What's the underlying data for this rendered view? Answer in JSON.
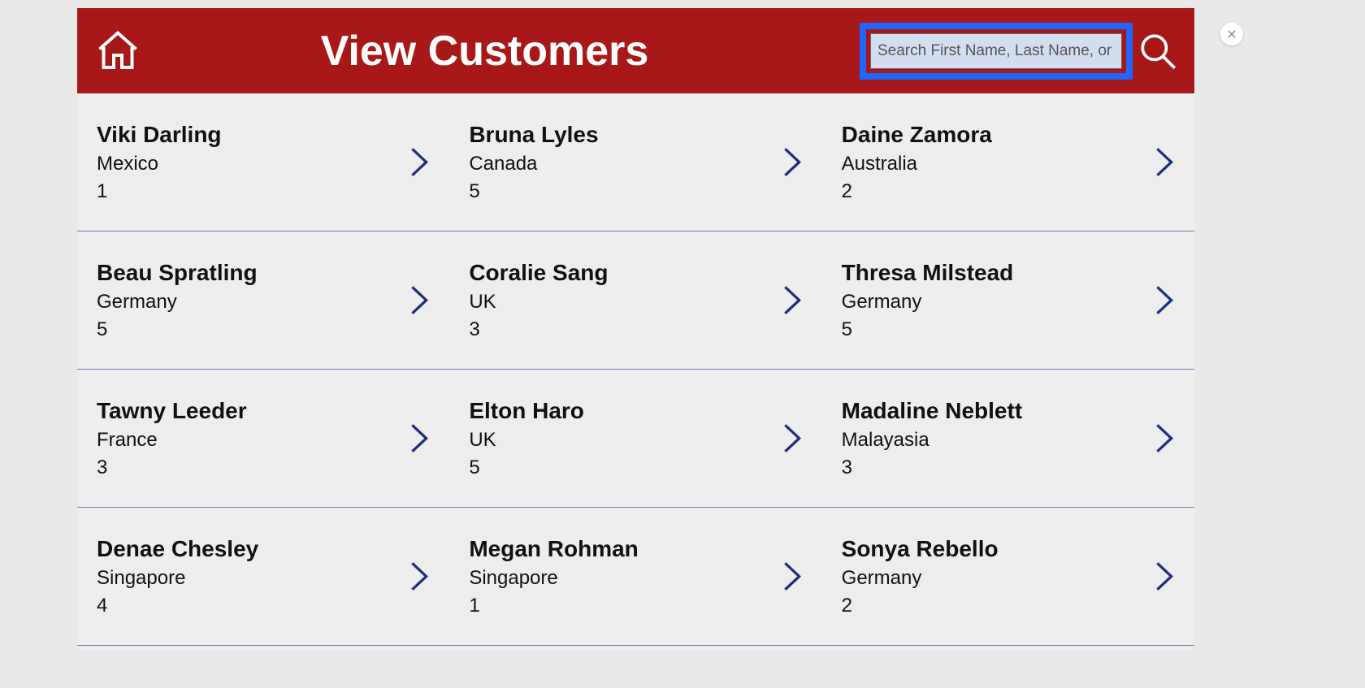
{
  "header": {
    "title": "View Customers"
  },
  "search": {
    "placeholder": "Search First Name, Last Name, or Age",
    "value": ""
  },
  "customers": [
    {
      "first": "Viki",
      "last": "Darling",
      "country": "Mexico",
      "num": "1"
    },
    {
      "first": "Bruna",
      "last": "Lyles",
      "country": "Canada",
      "num": "5"
    },
    {
      "first": "Daine",
      "last": "Zamora",
      "country": "Australia",
      "num": "2"
    },
    {
      "first": "Beau",
      "last": "Spratling",
      "country": "Germany",
      "num": "5"
    },
    {
      "first": "Coralie",
      "last": "Sang",
      "country": "UK",
      "num": "3"
    },
    {
      "first": "Thresa",
      "last": "Milstead",
      "country": "Germany",
      "num": "5"
    },
    {
      "first": "Tawny",
      "last": "Leeder",
      "country": "France",
      "num": "3"
    },
    {
      "first": "Elton",
      "last": "Haro",
      "country": "UK",
      "num": "5"
    },
    {
      "first": "Madaline",
      "last": "Neblett",
      "country": "Malayasia",
      "num": "3"
    },
    {
      "first": "Denae",
      "last": "Chesley",
      "country": "Singapore",
      "num": "4"
    },
    {
      "first": "Megan",
      "last": "Rohman",
      "country": "Singapore",
      "num": "1"
    },
    {
      "first": "Sonya",
      "last": "Rebello",
      "country": "Germany",
      "num": "2"
    }
  ]
}
